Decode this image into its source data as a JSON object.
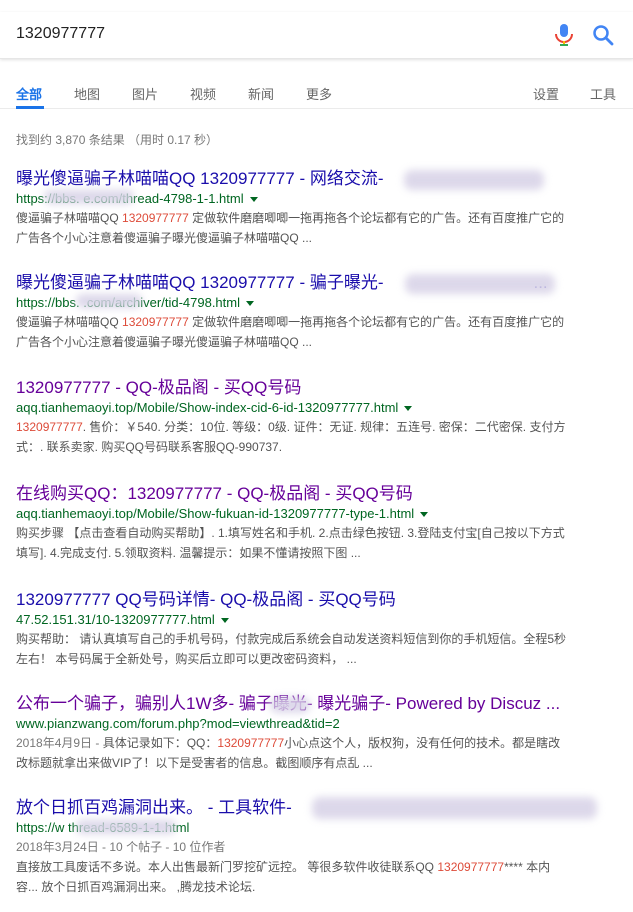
{
  "search": {
    "query": "1320977777"
  },
  "tabs": {
    "all": "全部",
    "maps": "地图",
    "images": "图片",
    "videos": "视频",
    "news": "新闻",
    "more": "更多",
    "settings": "设置",
    "tools": "工具"
  },
  "stats": "找到约 3,870 条结果 （用时 0.17 秒）",
  "results": [
    {
      "title": "曝光傻逼骗子林喵喵QQ 1320977777 - 网络交流-",
      "url": "https://bbs.           e.com/thread-4798-1-1.html",
      "snip1a": "傻逼骗子林喵喵QQ ",
      "hl1": "1320977777",
      "snip1b": " 定做软件磨磨唧唧一拖再拖各个论坛都有它的广告。还有百度推广它的",
      "snip2": "广告各个小心注意着傻逼骗子曝光傻逼骗子林喵喵QQ ..."
    },
    {
      "title": "曝光傻逼骗子林喵喵QQ 1320977777 - 骗子曝光-",
      "title_tail": "...",
      "url": "https://bbs.         .com/archiver/tid-4798.html",
      "snip1a": "傻逼骗子林喵喵QQ ",
      "hl1": "1320977777",
      "snip1b": " 定做软件磨磨唧唧一拖再拖各个论坛都有它的广告。还有百度推广它的",
      "snip2": "广告各个小心注意着傻逼骗子曝光傻逼骗子林喵喵QQ ..."
    },
    {
      "title": "1320977777 - QQ-极品阁 - 买QQ号码",
      "url": "aqq.tianhemaoyi.top/Mobile/Show-index-cid-6-id-1320977777.html",
      "hl1": "1320977777",
      "snip1b": ". 售价：￥540. 分类：10位. 等级：0级. 证件：无证. 规律：五连号. 密保：二代密保. 支付方",
      "snip2": "式：. 联系卖家. 购买QQ号码联系客服QQ-990737."
    },
    {
      "title": "在线购买QQ：1320977777 - QQ-极品阁 - 买QQ号码",
      "url": "aqq.tianhemaoyi.top/Mobile/Show-fukuan-id-1320977777-type-1.html",
      "snip1": "购买步骤 【点击查看自动购买帮助】. 1.填写姓名和手机. 2.点击绿色按钮. 3.登陆支付宝[自己按以下方式",
      "snip2": "填写]. 4.完成支付. 5.领取资料. 温馨提示：如果不懂请按照下图 ..."
    },
    {
      "title": "1320977777 QQ号码详情- QQ-极品阁 - 买QQ号码",
      "url": "47.52.151.31/10-1320977777.html",
      "snip1": "购买帮助： 请认真填写自己的手机号码，付款完成后系统会自动发送资料短信到你的手机短信。全程5秒",
      "snip2": "左右！ 本号码属于全新处号，购买后立即可以更改密码资料， ..."
    },
    {
      "title": "公布一个骗子，骗别人1W多- 骗子曝光- 曝光骗子- Powered by Discuz ...",
      "url": "www.pianzwang.com/forum.php?mod=viewthread&tid=2",
      "date": "2018年4月9日 - ",
      "snip1a": "具体记录如下：QQ：",
      "hl1": "1320977777",
      "snip1b": "小心点这个人，版权狗，没有任何的技术。都是瞎改",
      "snip2": "改标题就拿出来做VIP了！以下是受害者的信息。截图顺序有点乱 ..."
    },
    {
      "title": "放个日抓百鸡漏洞出来。 - 工具软件-",
      "url": "https://w              thread-6589-1-1.html",
      "date": "2018年3月24日 - 10 个帖子 - 10 位作者",
      "snip1a": "直接放工具废话不多说。本人出售最新门罗挖矿远控。 等很多软件收徒联系QQ ",
      "hl1": "1320977777",
      "snip1b": "**** 本内",
      "snip2": "容... 放个日抓百鸡漏洞出来。 ,腾龙技术论坛."
    }
  ]
}
